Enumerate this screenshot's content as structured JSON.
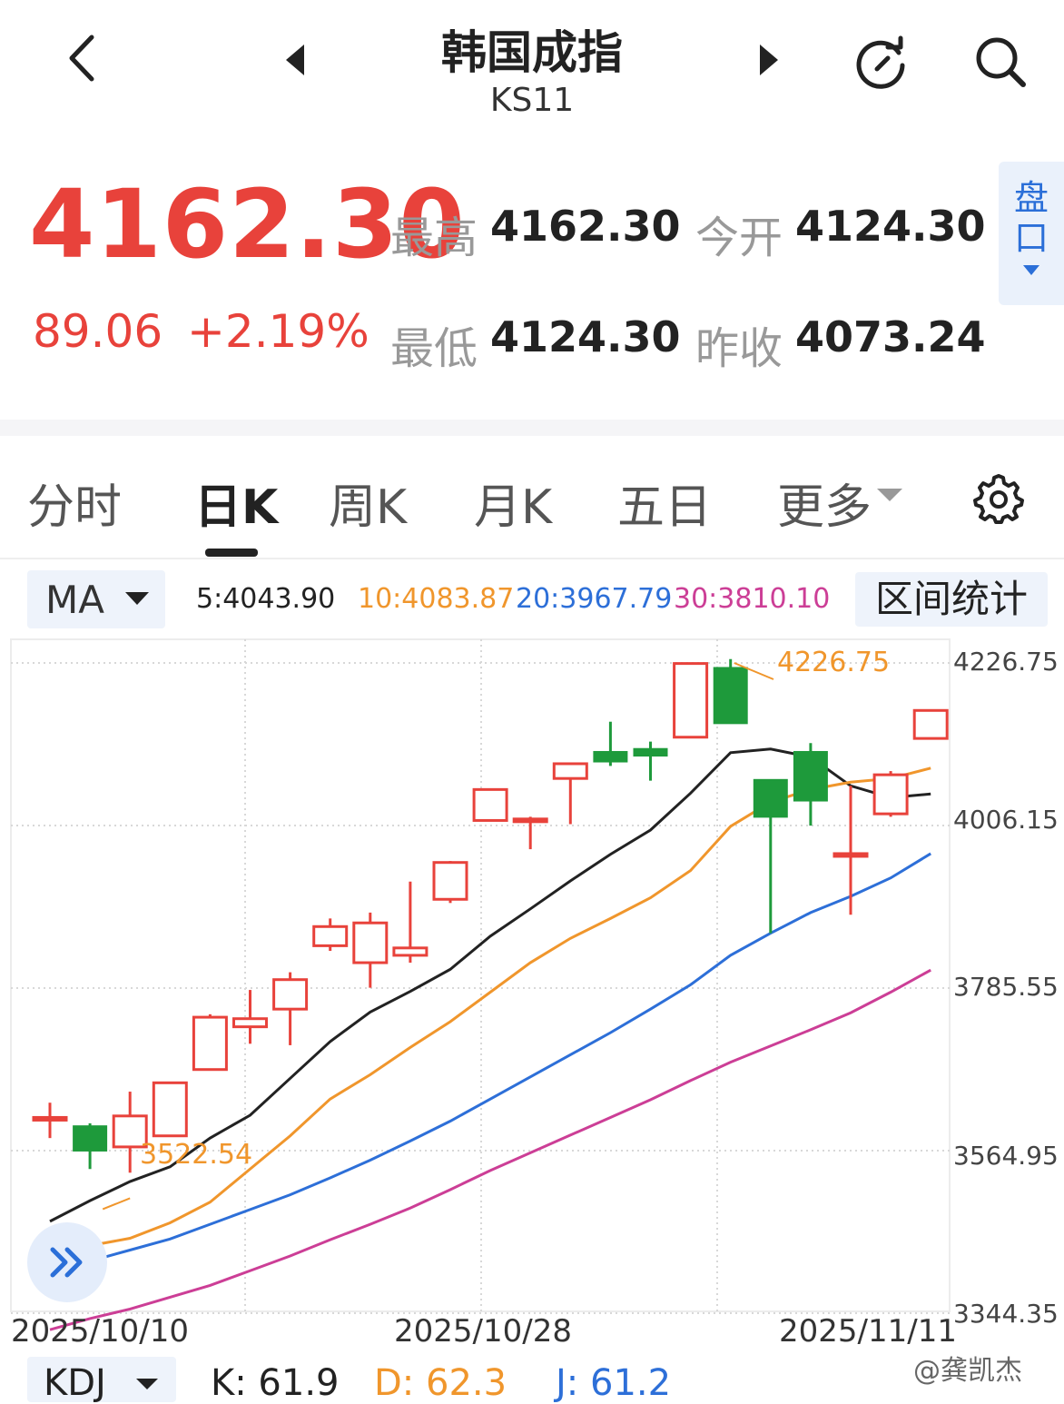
{
  "header": {
    "title": "韩国成指",
    "code": "KS11"
  },
  "quote": {
    "price": "4162.30",
    "change": "89.06",
    "change_pct": "+2.19%",
    "high_label": "最高",
    "high": "4162.30",
    "open_label": "今开",
    "open": "4124.30",
    "low_label": "最低",
    "low": "4124.30",
    "prev_close_label": "昨收",
    "prev_close": "4073.24",
    "pankou_label_1": "盘",
    "pankou_label_2": "口"
  },
  "tabs": [
    {
      "label": "分时",
      "active": false
    },
    {
      "label": "日K",
      "active": true
    },
    {
      "label": "周K",
      "active": false
    },
    {
      "label": "月K",
      "active": false
    },
    {
      "label": "五日",
      "active": false
    },
    {
      "label": "更多",
      "active": false
    }
  ],
  "indicator": {
    "selected": "MA",
    "ma5": "5:4043.90",
    "ma10": "10:4083.87",
    "ma20": "20:3967.79",
    "ma30": "30:3810.10",
    "range_stats": "区间统计"
  },
  "colors": {
    "up": "#e8423b",
    "down": "#1e9a3b",
    "ma5": "#222222",
    "ma10": "#f0962c",
    "ma20": "#2d6fd8",
    "ma30": "#cc3e96",
    "accent": "#2b6fd8"
  },
  "chart_data": {
    "type": "candlestick",
    "y_ticks": [
      "4226.75",
      "4006.15",
      "3785.55",
      "3564.95",
      "3344.35"
    ],
    "ylim": [
      3344.35,
      4226.75
    ],
    "x_ticks": [
      "2025/10/10",
      "2025/10/28",
      "2025/11/11"
    ],
    "max_label": "4226.75",
    "min_label": "3522.54",
    "candles": [
      {
        "o": 3610,
        "h": 3630,
        "l": 3582,
        "c": 3610
      },
      {
        "o": 3598,
        "h": 3602,
        "l": 3540,
        "c": 3565
      },
      {
        "o": 3570,
        "h": 3645,
        "l": 3535,
        "c": 3612
      },
      {
        "o": 3585,
        "h": 3656,
        "l": 3585,
        "c": 3657
      },
      {
        "o": 3675,
        "h": 3750,
        "l": 3675,
        "c": 3746
      },
      {
        "o": 3733,
        "h": 3783,
        "l": 3710,
        "c": 3744
      },
      {
        "o": 3757,
        "h": 3807,
        "l": 3708,
        "c": 3797
      },
      {
        "o": 3843,
        "h": 3880,
        "l": 3836,
        "c": 3869
      },
      {
        "o": 3820,
        "h": 3888,
        "l": 3786,
        "c": 3874
      },
      {
        "o": 3830,
        "h": 3930,
        "l": 3820,
        "c": 3840
      },
      {
        "o": 3906,
        "h": 3958,
        "l": 3901,
        "c": 3956
      },
      {
        "o": 4013,
        "h": 4055,
        "l": 4013,
        "c": 4055
      },
      {
        "o": 4015,
        "h": 4018,
        "l": 3974,
        "c": 4015
      },
      {
        "o": 4070,
        "h": 4090,
        "l": 4008,
        "c": 4090
      },
      {
        "o": 4106,
        "h": 4147,
        "l": 4087,
        "c": 4093
      },
      {
        "o": 4110,
        "h": 4120,
        "l": 4067,
        "c": 4101
      },
      {
        "o": 4126,
        "h": 4226.75,
        "l": 4126,
        "c": 4226
      },
      {
        "o": 4220,
        "h": 4232,
        "l": 4145,
        "c": 4145
      },
      {
        "o": 4068,
        "h": 4068,
        "l": 3860,
        "c": 4018
      },
      {
        "o": 4106,
        "h": 4118,
        "l": 4006,
        "c": 4040
      },
      {
        "o": 3968,
        "h": 4060,
        "l": 3885,
        "c": 3968
      },
      {
        "o": 4022,
        "h": 4080,
        "l": 4018,
        "c": 4075
      },
      {
        "o": 4124.3,
        "h": 4162.3,
        "l": 4124.3,
        "c": 4162.3
      }
    ],
    "series": [
      {
        "name": "5",
        "values": [
          3469,
          3497,
          3523,
          3543,
          3582,
          3613,
          3663,
          3713,
          3753,
          3781,
          3811,
          3856,
          3893,
          3931,
          3967,
          4000,
          4050,
          4105,
          4110,
          4099,
          4060,
          4044,
          4049
        ]
      },
      {
        "name": "10",
        "values": [
          3423,
          3436,
          3446,
          3467,
          3495,
          3540,
          3585,
          3635,
          3668,
          3705,
          3740,
          3780,
          3820,
          3853,
          3880,
          3908,
          3945,
          4005,
          4038,
          4055,
          4065,
          4070,
          4084
        ]
      },
      {
        "name": "20",
        "values": [
          3401,
          3415,
          3430,
          3445,
          3465,
          3485,
          3505,
          3528,
          3552,
          3578,
          3605,
          3635,
          3665,
          3695,
          3725,
          3757,
          3790,
          3830,
          3860,
          3888,
          3910,
          3935,
          3968
        ]
      },
      {
        "name": "30",
        "values": [
          3322,
          3337,
          3350,
          3366,
          3382,
          3402,
          3422,
          3444,
          3465,
          3487,
          3512,
          3538,
          3562,
          3586,
          3610,
          3634,
          3660,
          3685,
          3707,
          3729,
          3752,
          3780,
          3810
        ]
      }
    ]
  },
  "kdj": {
    "selected": "KDJ",
    "k": "K: 61.9",
    "d": "D: 62.3",
    "j": "J: 61.2"
  },
  "watermark": "@龚凯杰"
}
